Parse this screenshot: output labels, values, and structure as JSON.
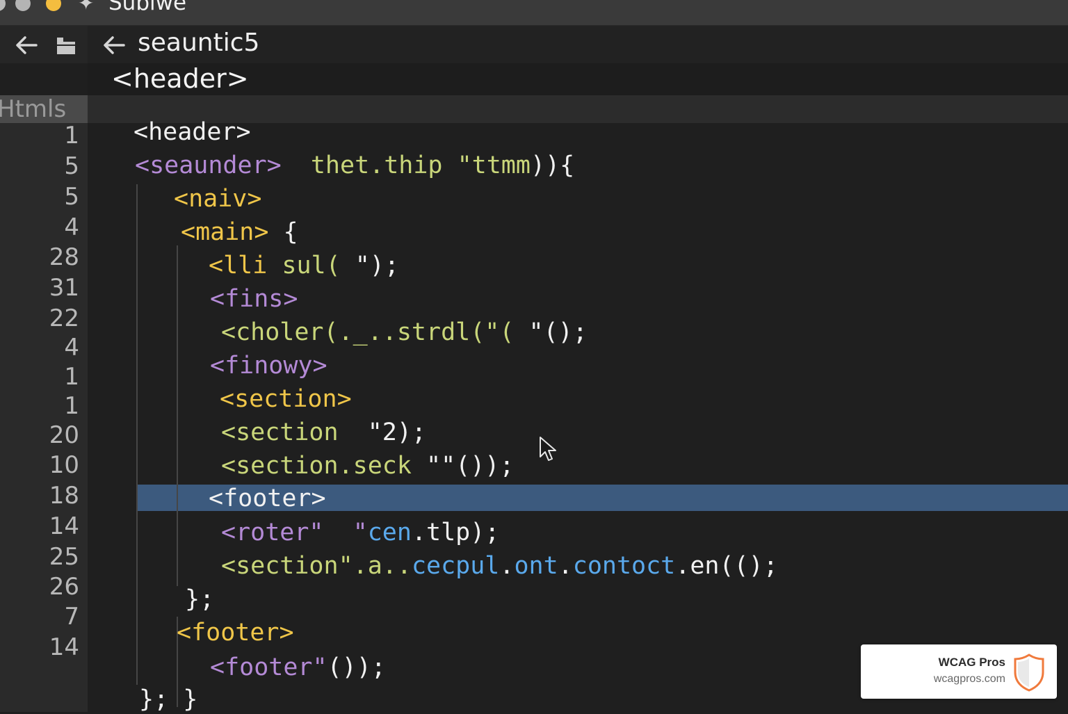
{
  "window": {
    "title": "Sublwe"
  },
  "breadcrumb": {
    "label": "seauntic5"
  },
  "header_line": "<header>",
  "tab": {
    "label": "Htmls"
  },
  "gutter": {
    "line_numbers": [
      "1",
      "5",
      "5",
      "4",
      "28",
      "31",
      "22",
      "4",
      "1",
      "1",
      "20",
      "10",
      "18",
      "14",
      "25",
      "26",
      "7",
      "14"
    ]
  },
  "code_lines": [
    {
      "segments": [
        {
          "text": "<header>",
          "color": "white"
        }
      ]
    },
    {
      "segments": [
        {
          "text": "<seaunder>",
          "color": "purple"
        },
        {
          "text": "  thet.thip \"ttmm",
          "color": "green"
        },
        {
          "text": ")){",
          "color": "white"
        }
      ]
    },
    {
      "segments": [
        {
          "text": "<naiv>",
          "color": "yellow"
        }
      ]
    },
    {
      "segments": [
        {
          "text": "<main>",
          "color": "yellow"
        },
        {
          "text": " {",
          "color": "white"
        }
      ]
    },
    {
      "segments": [
        {
          "text": "<lli",
          "color": "yellow"
        },
        {
          "text": " sul(",
          "color": "green"
        },
        {
          "text": " \");",
          "color": "white"
        }
      ]
    },
    {
      "segments": [
        {
          "text": "<fins>",
          "color": "purple"
        }
      ]
    },
    {
      "segments": [
        {
          "text": "<choler(._..strdl(\"(",
          "color": "green"
        },
        {
          "text": " \"();",
          "color": "white"
        }
      ]
    },
    {
      "segments": [
        {
          "text": "<finowy>",
          "color": "purple"
        }
      ]
    },
    {
      "segments": [
        {
          "text": "<section>",
          "color": "yellow"
        }
      ]
    },
    {
      "segments": [
        {
          "text": "<section",
          "color": "green"
        },
        {
          "text": "  \"2);",
          "color": "white"
        }
      ]
    },
    {
      "segments": [
        {
          "text": "<section.seck",
          "color": "green"
        },
        {
          "text": " \"\"());",
          "color": "white"
        }
      ]
    },
    {
      "segments": [
        {
          "text": "<footer>",
          "color": "white"
        }
      ]
    },
    {
      "segments": [
        {
          "text": "<roter\"  \"",
          "color": "purple"
        },
        {
          "text": "cen",
          "color": "blue"
        },
        {
          "text": ".tlp);",
          "color": "white"
        }
      ]
    },
    {
      "segments": [
        {
          "text": "<section\".a..",
          "color": "green"
        },
        {
          "text": "cecpul",
          "color": "blue"
        },
        {
          "text": ".",
          "color": "white"
        },
        {
          "text": "ont",
          "color": "blue"
        },
        {
          "text": ".",
          "color": "white"
        },
        {
          "text": "contoct",
          "color": "blue"
        },
        {
          "text": ".en(();",
          "color": "white"
        }
      ]
    },
    {
      "segments": [
        {
          "text": "};",
          "color": "white"
        }
      ]
    },
    {
      "segments": [
        {
          "text": "<footer>",
          "color": "yellow"
        }
      ]
    },
    {
      "segments": [
        {
          "text": "<footer\"",
          "color": "purple"
        },
        {
          "text": "());",
          "color": "white"
        }
      ]
    },
    {
      "segments": [
        {
          "text": "}; }",
          "color": "white"
        }
      ]
    }
  ],
  "badge": {
    "name": "WCAG Pros",
    "url": "wcagpros.com"
  },
  "colors": {
    "white": "#f1f1f1",
    "purple": "#b48ad6",
    "yellow": "#f0c649",
    "green": "#c9d67a",
    "blue": "#5aa9ec",
    "highlight": "#3c5a7e",
    "shield": "#f07a3c"
  },
  "icons": {
    "back": "arrow-left-icon",
    "folder": "folder-icon",
    "cursor": "mouse-pointer-icon",
    "shield": "shield-icon"
  }
}
